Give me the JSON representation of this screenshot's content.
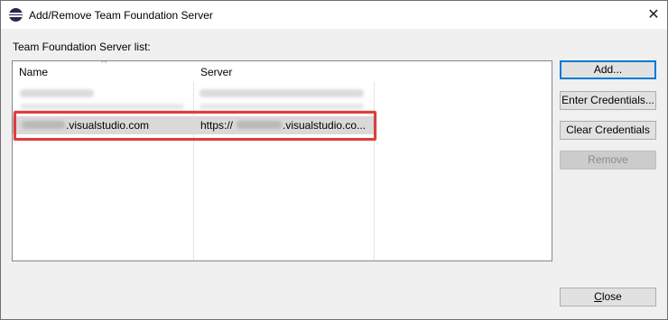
{
  "window": {
    "title": "Add/Remove Team Foundation Server",
    "close_glyph": "✕",
    "app_icon": "eclipse-icon"
  },
  "list": {
    "label": "Team Foundation Server list:",
    "columns": [
      "Name",
      "Server"
    ],
    "sort_indicator": "^",
    "rows": [
      {
        "name": "",
        "server": ""
      },
      {
        "name": "",
        "server": ""
      },
      {
        "name": ".visualstudio.com",
        "server_prefix": "https://",
        "server_suffix": ".visualstudio.co..."
      }
    ]
  },
  "buttons": {
    "add": "Add...",
    "enter_credentials": "Enter Credentials...",
    "clear_credentials": "Clear Credentials",
    "remove": "Remove",
    "close_first": "C",
    "close_rest": "lose"
  },
  "colors": {
    "highlight": "#e03c3c",
    "default_button_border": "#0078d7",
    "selected_row": "#d9d9d9"
  }
}
